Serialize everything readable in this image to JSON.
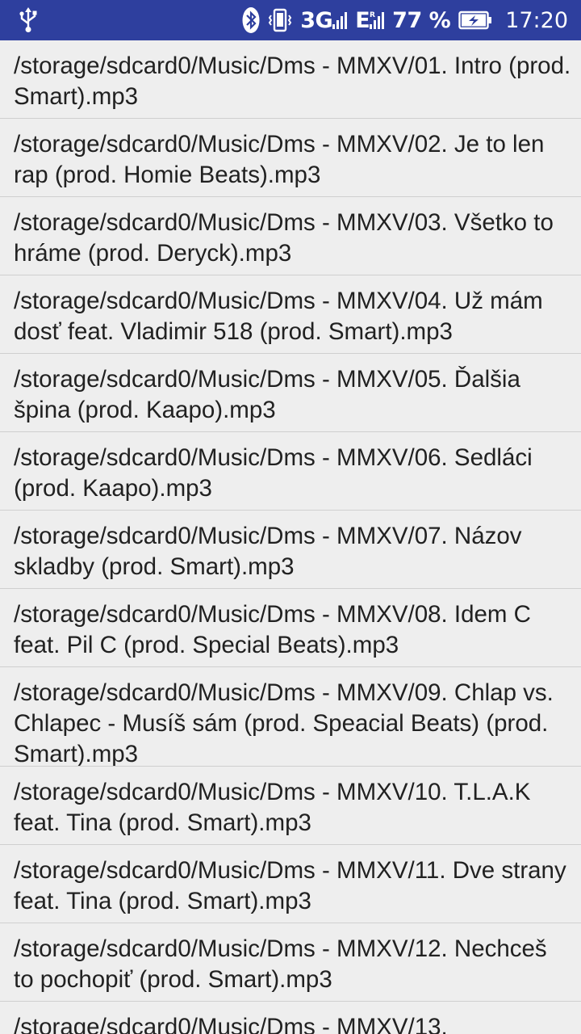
{
  "status_bar": {
    "network_label": "3G",
    "roaming_label": "E",
    "battery_percent": "77 %",
    "time": "17:20",
    "icons": [
      "usb-icon",
      "bluetooth-icon",
      "vibrate-icon",
      "signal-3g-icon",
      "signal-e-icon",
      "battery-charging-icon"
    ],
    "background_color": "#2e3f9e"
  },
  "files": [
    {
      "path": "/storage/sdcard0/Music/Dms - MMXV/01. Intro (prod. Smart).mp3"
    },
    {
      "path": "/storage/sdcard0/Music/Dms - MMXV/02. Je to len rap (prod. Homie Beats).mp3"
    },
    {
      "path": "/storage/sdcard0/Music/Dms - MMXV/03. Všetko to hráme (prod. Deryck).mp3"
    },
    {
      "path": "/storage/sdcard0/Music/Dms - MMXV/04. Už mám dosť feat. Vladimir 518 (prod. Smart).mp3"
    },
    {
      "path": "/storage/sdcard0/Music/Dms - MMXV/05. Ďalšia špina (prod. Kaapo).mp3"
    },
    {
      "path": "/storage/sdcard0/Music/Dms - MMXV/06. Sedláci (prod. Kaapo).mp3"
    },
    {
      "path": "/storage/sdcard0/Music/Dms - MMXV/07. Názov skladby (prod. Smart).mp3"
    },
    {
      "path": "/storage/sdcard0/Music/Dms - MMXV/08. Idem C feat. Pil C (prod. Special Beats).mp3"
    },
    {
      "path": "/storage/sdcard0/Music/Dms - MMXV/09. Chlap vs. Chlapec - Musíš sám (prod. Speacial Beats) (prod. Smart).mp3"
    },
    {
      "path": "/storage/sdcard0/Music/Dms - MMXV/10. T.L.A.K feat. Tina (prod. Smart).mp3"
    },
    {
      "path": "/storage/sdcard0/Music/Dms - MMXV/11. Dve strany feat. Tina (prod. Smart).mp3"
    },
    {
      "path": "/storage/sdcard0/Music/Dms - MMXV/12. Nechceš to pochopiť (prod. Smart).mp3"
    },
    {
      "path": "/storage/sdcard0/Music/Dms - MMXV/13."
    }
  ]
}
